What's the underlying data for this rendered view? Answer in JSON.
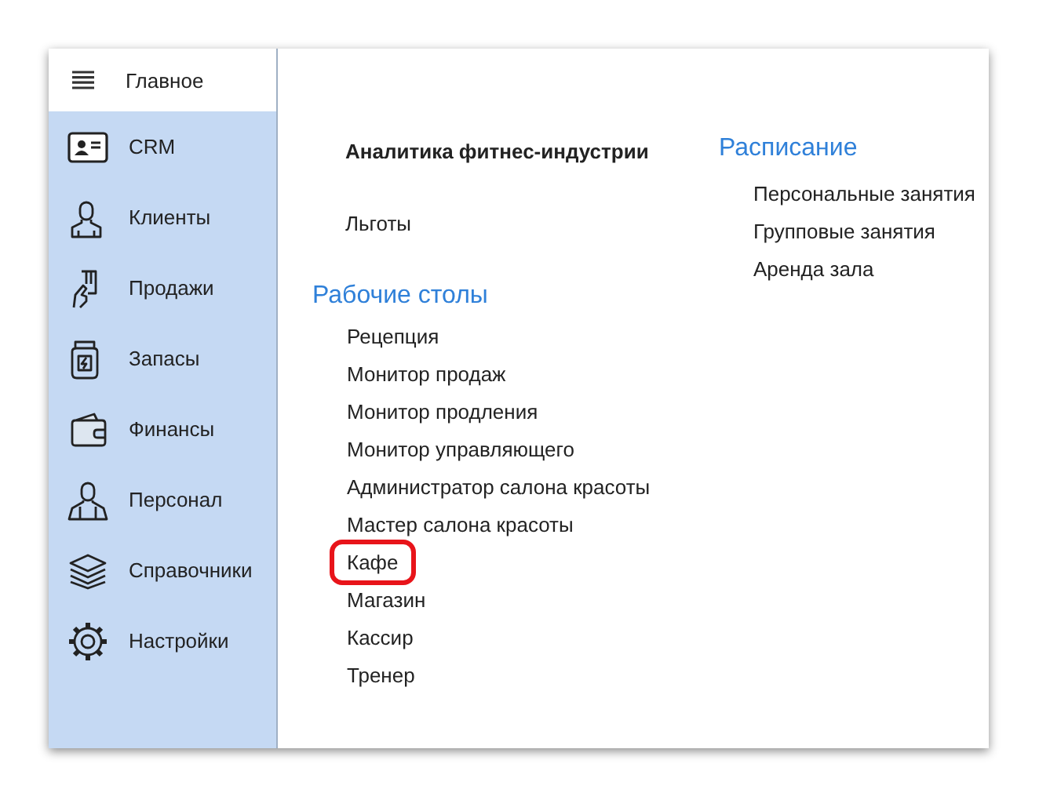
{
  "sidebar": {
    "header": {
      "label": "Главное"
    },
    "items": [
      {
        "label": "CRM",
        "kind": "card"
      },
      {
        "label": "Клиенты",
        "kind": "person"
      },
      {
        "label": "Продажи",
        "kind": "hand"
      },
      {
        "label": "Запасы",
        "kind": "jar"
      },
      {
        "label": "Финансы",
        "kind": "wallet"
      },
      {
        "label": "Персонал",
        "kind": "staff"
      },
      {
        "label": "Справочники",
        "kind": "layers"
      },
      {
        "label": "Настройки",
        "kind": "gear"
      }
    ]
  },
  "left_column": {
    "title": "Аналитика фитнес-индустрии",
    "benefits": "Льготы",
    "section": {
      "heading": "Рабочие столы",
      "items": [
        {
          "label": "Рецепция",
          "highlighted": false
        },
        {
          "label": "Монитор продаж",
          "highlighted": false
        },
        {
          "label": "Монитор продления",
          "highlighted": false
        },
        {
          "label": "Монитор управляющего",
          "highlighted": false
        },
        {
          "label": "Администратор салона красоты",
          "highlighted": false
        },
        {
          "label": "Мастер салона красоты",
          "highlighted": false
        },
        {
          "label": "Кафе",
          "highlighted": true
        },
        {
          "label": "Магазин",
          "highlighted": false
        },
        {
          "label": "Кассир",
          "highlighted": false
        },
        {
          "label": "Тренер",
          "highlighted": false
        }
      ]
    }
  },
  "right_column": {
    "heading": "Расписание",
    "items": [
      {
        "label": "Персональные занятия"
      },
      {
        "label": "Групповые занятия"
      },
      {
        "label": "Аренда зала"
      }
    ]
  }
}
